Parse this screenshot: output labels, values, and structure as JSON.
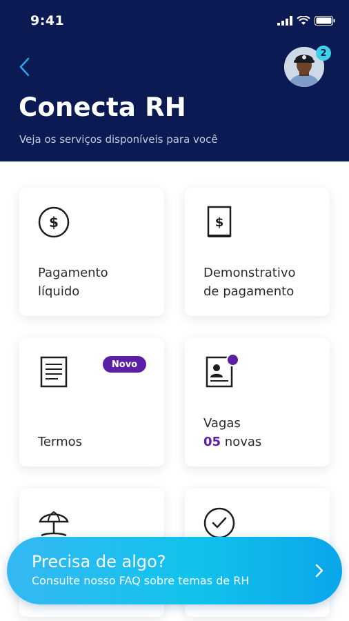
{
  "status_bar": {
    "time": "9:41"
  },
  "header": {
    "title": "Conecta RH",
    "subtitle": "Veja os serviços disponíveis para você",
    "notification_count": "2"
  },
  "cards": [
    {
      "line1": "Pagamento",
      "line2": "líquido",
      "icon": "dollar-coin-icon"
    },
    {
      "line1": "Demonstrativo",
      "line2": "de pagamento",
      "icon": "pay-slip-icon"
    },
    {
      "line1": "Termos",
      "icon": "document-icon",
      "tag": "Novo"
    },
    {
      "line1": "Vagas",
      "count": "05",
      "count_suffix": " novas",
      "icon": "job-badge-icon"
    },
    {
      "icon": "beach-umbrella-icon"
    },
    {
      "icon": "clock-check-icon"
    }
  ],
  "faq": {
    "title": "Precisa de algo?",
    "subtitle": "Consulte nosso FAQ sobre temas de RH"
  },
  "colors": {
    "header_bg": "#0b1a52",
    "accent_purple": "#5b1fa3",
    "badge_cyan": "#3fd1e8",
    "faq_gradient_start": "#35b8f2",
    "faq_gradient_end": "#0aa6ea"
  }
}
